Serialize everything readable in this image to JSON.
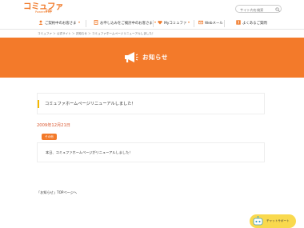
{
  "header": {
    "logo": {
      "text": "コミュファ",
      "sub": "Powered by",
      "ctc": "ctc"
    },
    "search": {
      "placeholder": "サイト内を検索"
    }
  },
  "nav": {
    "items": [
      {
        "label": "ご契約中のお客さま"
      },
      {
        "label": "お申し込みをご検討中のお客さま"
      },
      {
        "label": "Myコミュファ"
      },
      {
        "label": "Webメール"
      },
      {
        "label": "よくあるご質問"
      }
    ]
  },
  "breadcrumb": "コミュファ ＞ 公式サイト ＞ お知らせ ＞ コミュファホームページリニューアルしました！",
  "banner": {
    "title": "お知らせ"
  },
  "article": {
    "title": "コミュファホームページリニューアルしました！",
    "date": "2009年12月21日",
    "tag": "その他",
    "body": "本日、コミュファホームページがリニューアルしました！"
  },
  "footer": {
    "back_link": "「お知らせ」TOPページへ"
  },
  "chat": {
    "label": "チャットサポート"
  },
  "colors": {
    "accent": "#f37a2a",
    "date": "#d9532a",
    "title_bar": "#f5b800",
    "chat": "#f9d94e"
  }
}
